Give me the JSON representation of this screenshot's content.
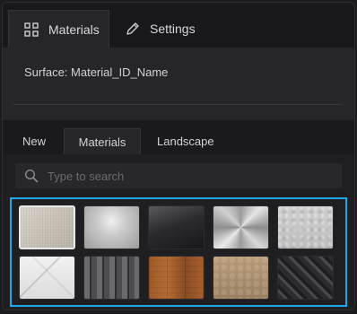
{
  "top_tabs": [
    {
      "label": "Materials",
      "icon": "grid-icon",
      "active": true
    },
    {
      "label": "Settings",
      "icon": "pencil-icon",
      "active": false
    }
  ],
  "surface": {
    "label": "Surface: Material_ID_Name"
  },
  "library_tabs": [
    {
      "label": "New"
    },
    {
      "label": "Materials"
    },
    {
      "label": "Landscape"
    }
  ],
  "search": {
    "placeholder": "Type to search",
    "value": ""
  },
  "materials": [
    {
      "name": "fabric-texture",
      "selected": true
    },
    {
      "name": "polished-silver"
    },
    {
      "name": "dark-glossy"
    },
    {
      "name": "brushed-metal"
    },
    {
      "name": "stucco"
    },
    {
      "name": "white-marble"
    },
    {
      "name": "roof-tiles"
    },
    {
      "name": "wood-planks"
    },
    {
      "name": "sandstone"
    },
    {
      "name": "dark-weave"
    }
  ],
  "colors": {
    "accent": "#1ea7e8",
    "panel": "#1f1f22",
    "tab_active": "#262629"
  }
}
